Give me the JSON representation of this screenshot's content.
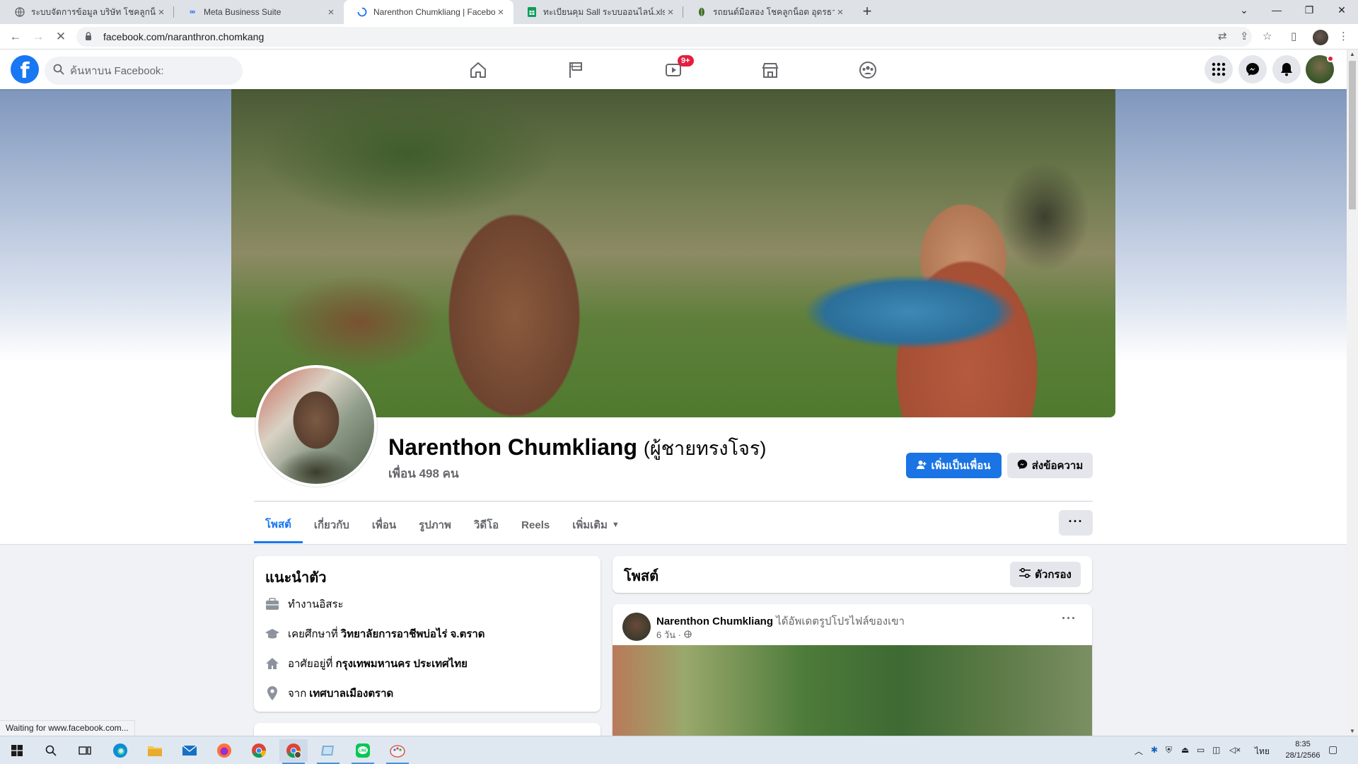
{
  "browser": {
    "tabs": [
      {
        "title": "ระบบจัดการข้อมูล บริษัท โชคลูกน็อต",
        "icon": "globe-icon",
        "active": false
      },
      {
        "title": "Meta Business Suite",
        "icon": "meta-icon",
        "active": false
      },
      {
        "title": "Narenthon Chumkliang | Facebook",
        "icon": "loading-icon",
        "active": true
      },
      {
        "title": "ทะเบียนคุม Sall ระบบออนไลน์.xlsx - G",
        "icon": "sheets-icon",
        "active": false
      },
      {
        "title": "รถยนต์มือสอง โชคลูกน็อต อุดรธานี",
        "icon": "leaf-icon",
        "active": false
      }
    ],
    "url": "facebook.com/naranthron.chomkang",
    "status_text": "Waiting for www.facebook.com..."
  },
  "facebook": {
    "logo": "f",
    "search_placeholder": "ค้นหาบน Facebook:",
    "nav": [
      {
        "name": "home",
        "icon": "home-icon"
      },
      {
        "name": "pages",
        "icon": "flag-icon"
      },
      {
        "name": "watch",
        "icon": "video-icon",
        "badge": "9+"
      },
      {
        "name": "marketplace",
        "icon": "store-icon"
      },
      {
        "name": "groups",
        "icon": "groups-icon"
      }
    ]
  },
  "profile": {
    "name": "Narenthon Chumkliang",
    "alt_name": "(ผู้ชายทรงโจร)",
    "friends": "เพื่อน 498 คน",
    "add_friend_label": "เพิ่มเป็นเพื่อน",
    "message_label": "ส่งข้อความ",
    "tabs": [
      "โพสต์",
      "เกี่ยวกับ",
      "เพื่อน",
      "รูปภาพ",
      "วิดีโอ",
      "Reels",
      "เพิ่มเติม"
    ],
    "more_label": "···"
  },
  "intro": {
    "title": "แนะนำตัว",
    "items": [
      {
        "icon": "work-icon",
        "text": "ทำงานอิสระ",
        "strong": ""
      },
      {
        "icon": "education-icon",
        "text": "เคยศึกษาที่",
        "strong": "วิทยาลัยการอาชีพบ่อไร่ จ.ตราด"
      },
      {
        "icon": "home-icon",
        "text": "อาศัยอยู่ที่",
        "strong": "กรุงเทพมหานคร ประเทศไทย"
      },
      {
        "icon": "location-icon",
        "text": "จาก",
        "strong": "เทศบาลเมืองตราด"
      }
    ]
  },
  "posts": {
    "title": "โพสต์",
    "filter_label": "ตัวกรอง",
    "items": [
      {
        "author": "Narenthon Chumkliang",
        "action": "ได้อัพเดตรูปโปรไฟล์ของเขา",
        "time": "6 วัน ·",
        "privacy_icon": "globe-icon"
      }
    ]
  },
  "taskbar": {
    "lang": "ไทย",
    "time": "8:35",
    "date": "28/1/2566"
  }
}
